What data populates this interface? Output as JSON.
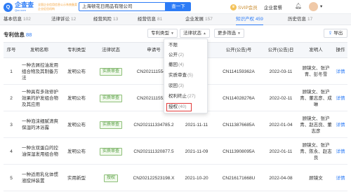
{
  "topbar": {
    "logo_cn": "企查查",
    "logo_en": "Qcc.com",
    "slogan": "全国企业信用信息公示系统备案企业征信机构",
    "search_value": "上海顿花日用品有限公司",
    "search_button": "查一下",
    "svip_label": "SVIP会员",
    "firm_label": "企业套餐"
  },
  "tabs": [
    {
      "label": "基本信息",
      "count": "102"
    },
    {
      "label": "法律诉讼",
      "count": "12"
    },
    {
      "label": "经营风险",
      "count": "13"
    },
    {
      "label": "经营信息",
      "count": "81"
    },
    {
      "label": "企业发展",
      "count": "157"
    },
    {
      "label": "知识产权",
      "count": "459"
    },
    {
      "label": "历史信息",
      "count": "17"
    }
  ],
  "section": {
    "title": "专利信息",
    "count": "88",
    "filters": [
      "专利类型",
      "法律状态",
      "更多筛选"
    ],
    "export_label": "导出"
  },
  "table": {
    "headers": [
      "序号",
      "发明名称",
      "专利类型",
      "法律状态",
      "申请号",
      "申请日期",
      "公开(公告)号",
      "公开(公告)日",
      "发明人",
      "操作"
    ],
    "rows": [
      {
        "no": "1",
        "title": "一种去屑控油发用组合物及其制备方法",
        "type": "发明公布",
        "status": "实质审查",
        "app_no": "CN20211155494",
        "app_date": "",
        "pub_no": "CN114159362A",
        "pub_date": "2022-03-11",
        "inventor": "顾镜文、张沪青、彭冬雪",
        "action": "详情"
      },
      {
        "no": "2",
        "title": "一种具有多效修护效果的护发组合物及其应用",
        "type": "发明公布",
        "status": "实质审查",
        "app_no": "CN20211155283",
        "app_date": "",
        "pub_no": "CN114028276A",
        "pub_date": "2022-02-11",
        "inventor": "顾镜文、张沪青、董志彦、成琳",
        "action": "详情"
      },
      {
        "no": "3",
        "title": "一种泡沫细腻清爽保湿的沐浴露",
        "type": "发明公布",
        "status": "实质审查",
        "app_no": "CN202111334785.2",
        "app_date": "2021-11-11",
        "pub_no": "CN113876685A",
        "pub_date": "2022-01-04",
        "inventor": "顾镜文、张沪青、赵志良、董志彦",
        "action": "详情"
      },
      {
        "no": "4",
        "title": "一种含双蛋白的控油保湿发用组合物",
        "type": "发明公布",
        "status": "实质审查",
        "app_no": "CN202111320877.5",
        "app_date": "2021-11-09",
        "pub_no": "CN113908095A",
        "pub_date": "2022-01-11",
        "inventor": "顾镜文、张沪青、陈永、赵志良",
        "action": "详情"
      },
      {
        "no": "5",
        "title": "一种适用乳化体惯液搅拌装置",
        "type": "实用新型",
        "status": "授权",
        "app_no": "CN202122523198.X",
        "app_date": "2021-10-20",
        "pub_no": "CN216171668U",
        "pub_date": "2022-04-08",
        "inventor": "顾镜文",
        "action": "详情"
      }
    ]
  },
  "dropdown": {
    "items": [
      {
        "label": "不限",
        "count": ""
      },
      {
        "label": "公开",
        "count": "(2)"
      },
      {
        "label": "撤回",
        "count": "(4)"
      },
      {
        "label": "实质审查",
        "count": "(5)"
      },
      {
        "label": "驳回",
        "count": "(3)"
      },
      {
        "label": "权利终止",
        "count": "(27)"
      },
      {
        "label": "授权",
        "count": "(40)"
      }
    ],
    "selected_index": 6,
    "highlight_color": "#e23b3b"
  },
  "colors": {
    "accent": "#2d7cf6",
    "status_green": "#4f9a3a"
  }
}
